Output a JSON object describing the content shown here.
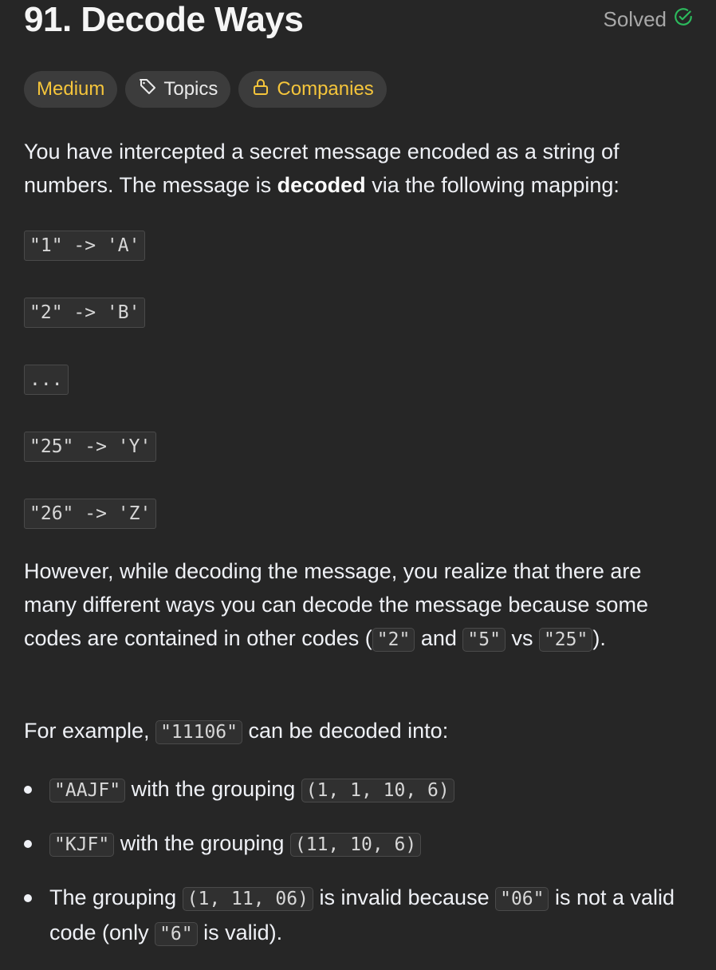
{
  "problem": {
    "number_title": "91. Decode Ways",
    "status": "Solved",
    "tags": {
      "difficulty": "Medium",
      "topics": "Topics",
      "companies": "Companies"
    }
  },
  "description": {
    "intro_part1": "You have intercepted a secret message encoded as a string of numbers. The message is ",
    "intro_bold": "decoded",
    "intro_part2": " via the following mapping:",
    "mappings": [
      "\"1\" -> 'A'",
      "\"2\" -> 'B'",
      "...",
      "\"25\" -> 'Y'",
      "\"26\" -> 'Z'"
    ],
    "however_part1": "However, while decoding the message, you realize that there are many different ways you can decode the message because some codes are contained in other codes (",
    "however_code1": "\"2\"",
    "however_and": " and ",
    "however_code2": "\"5\"",
    "however_vs": " vs ",
    "however_code3": "\"25\"",
    "however_end": ").",
    "example_part1": "For example, ",
    "example_code": "\"11106\"",
    "example_part2": " can be decoded into:",
    "bullets": [
      {
        "code1": "\"AAJF\"",
        "text1": " with the grouping ",
        "code2": "(1, 1, 10, 6)"
      },
      {
        "code1": "\"KJF\"",
        "text1": " with the grouping ",
        "code2": "(11, 10, 6)"
      },
      {
        "text0": "The grouping ",
        "code1": "(1, 11, 06)",
        "text1": " is invalid because ",
        "code2": "\"06\"",
        "text2": " is not a valid code (only ",
        "code3": "\"6\"",
        "text3": " is valid)."
      }
    ]
  },
  "colors": {
    "background": "#262626",
    "text": "#eff1f6",
    "difficulty_medium": "#f5c53b",
    "solved_check": "#2cbb5d"
  },
  "icons": [
    "check-circle-icon",
    "tag-icon",
    "lock-icon"
  ]
}
